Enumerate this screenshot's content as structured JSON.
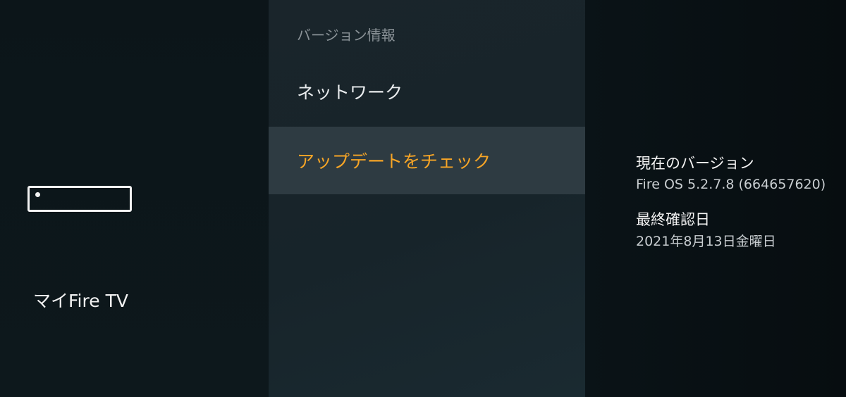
{
  "left": {
    "device_label": "マイFire TV"
  },
  "menu": {
    "items": [
      {
        "label": "バージョン情報"
      },
      {
        "label": "ネットワーク"
      },
      {
        "label": "アップデートをチェック"
      }
    ]
  },
  "details": {
    "current_version_label": "現在のバージョン",
    "current_version_value": "Fire OS 5.2.7.8 (664657620)",
    "last_checked_label": "最終確認日",
    "last_checked_value": "2021年8月13日金曜日"
  },
  "colors": {
    "selected_text": "#f7a526",
    "selected_background": "#2e3b42"
  }
}
